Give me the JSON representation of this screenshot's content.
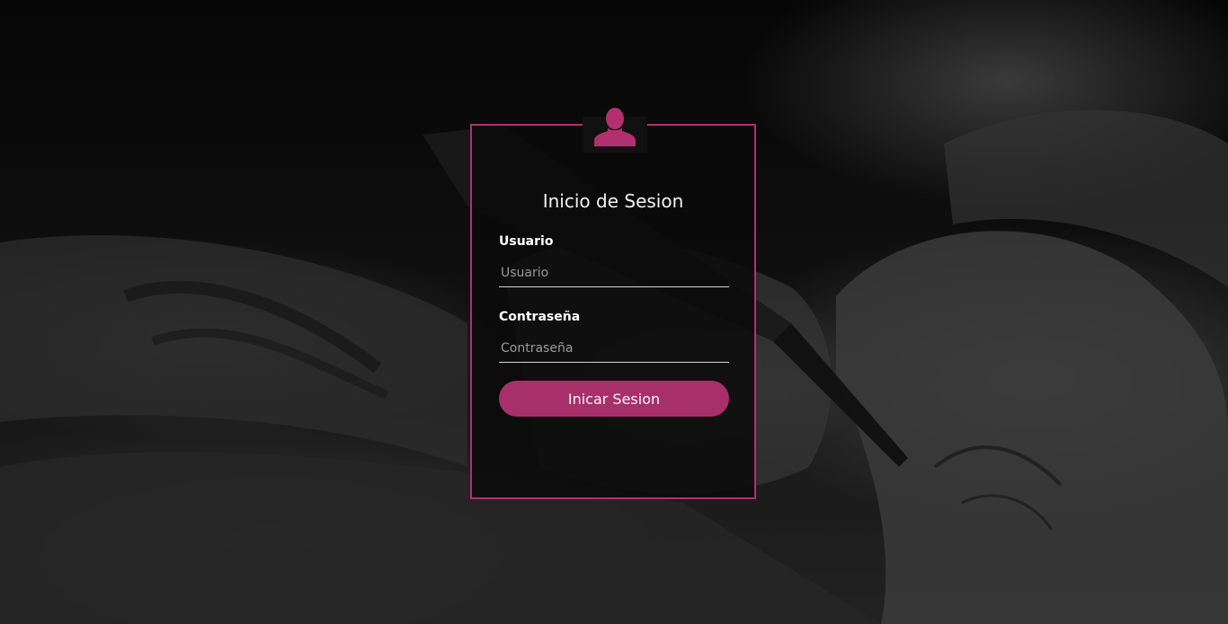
{
  "login": {
    "title": "Inicio de Sesion",
    "user_label": "Usuario",
    "user_placeholder": "Usuario",
    "user_value": "",
    "password_label": "Contraseña",
    "password_placeholder": "Contraseña",
    "password_value": "",
    "submit_label": "Inicar Sesion"
  },
  "icons": {
    "avatar": "user-silhouette-icon"
  },
  "colors": {
    "accent": "#b3306e",
    "button": "#a8306a"
  }
}
